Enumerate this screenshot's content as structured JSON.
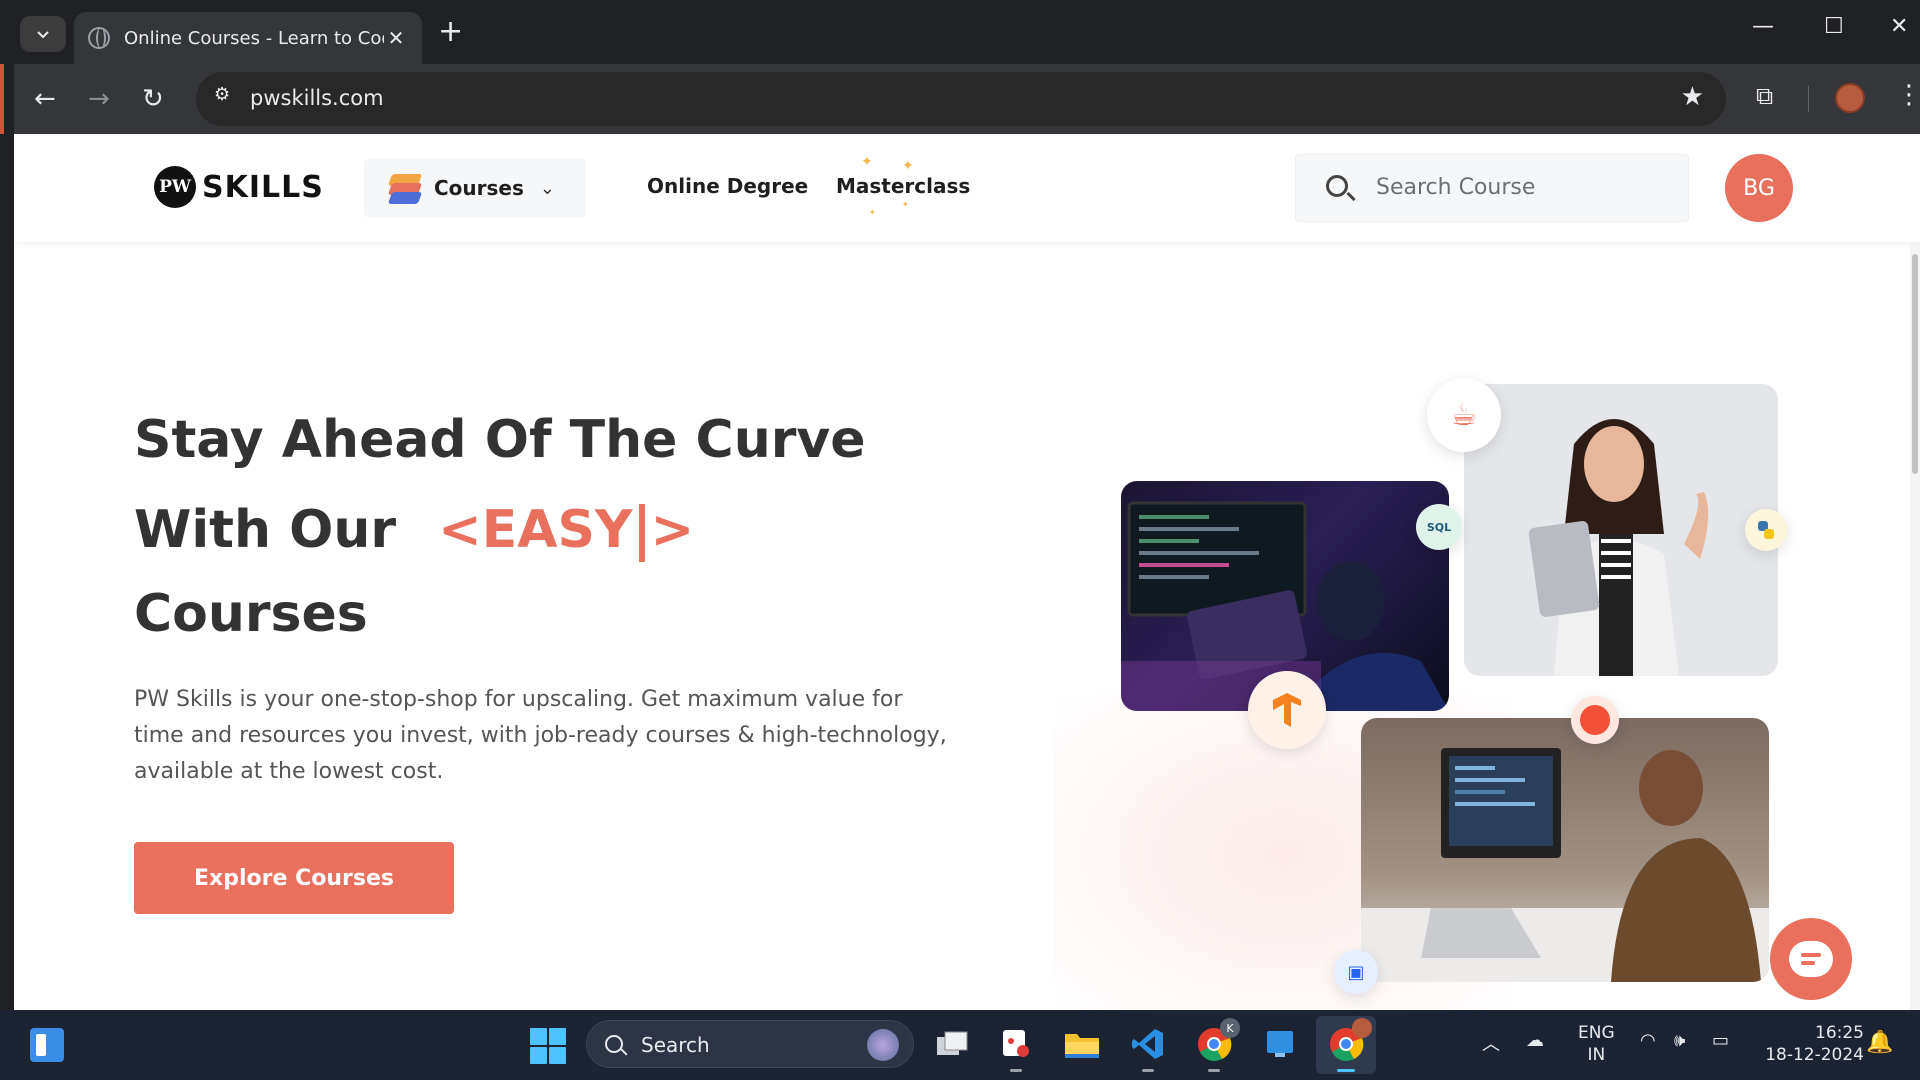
{
  "browser": {
    "tab_title": "Online Courses - Learn to Code",
    "url": "pwskills.com"
  },
  "site": {
    "logo_mark": "PW",
    "logo_text": "SKILLS",
    "nav": {
      "courses": "Courses",
      "online_degree": "Online Degree",
      "masterclass": "Masterclass"
    },
    "search_placeholder": "Search Course",
    "user_initials": "BG"
  },
  "hero": {
    "title_line1": "Stay Ahead Of The Curve",
    "title_line2": "With Our",
    "highlight_open": "<EASY",
    "highlight_close": ">",
    "title_line3": "Courses",
    "description": "PW Skills is your one-stop-shop for upscaling. Get maximum value for time and resources you invest, with job-ready courses & high-technology, available at the lowest cost.",
    "cta": "Explore Courses"
  },
  "badges": {
    "sql": "SQL"
  },
  "taskbar": {
    "search_label": "Search",
    "lang_line1": "ENG",
    "lang_line2": "IN",
    "time": "16:25",
    "date": "18-12-2024",
    "chrome_badge": "K"
  },
  "colors": {
    "brand": "#e8705c",
    "heading": "#333333"
  }
}
